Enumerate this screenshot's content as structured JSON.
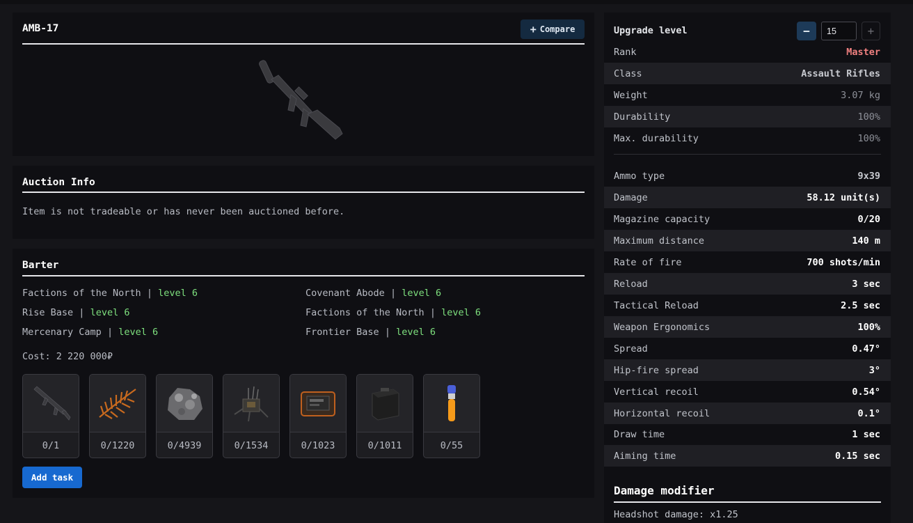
{
  "item": {
    "title": "AMB-17",
    "compare_label": "Compare",
    "compare_icon": "plus-icon"
  },
  "auction": {
    "title": "Auction Info",
    "text": "Item is not tradeable or has never been auctioned before."
  },
  "barter": {
    "title": "Barter",
    "separator": "|",
    "locations": [
      {
        "name": "Factions of the North",
        "level": "level 6"
      },
      {
        "name": "Covenant Abode",
        "level": "level 6"
      },
      {
        "name": "Rise Base",
        "level": "level 6"
      },
      {
        "name": "Factions of the North",
        "level": "level 6"
      },
      {
        "name": "Mercenary Camp",
        "level": "level 6"
      },
      {
        "name": "Frontier Base",
        "level": "level 6"
      }
    ],
    "cost": "Cost: 2 220 000₽",
    "materials": [
      {
        "icon": "rifle-icon",
        "count": "0/1"
      },
      {
        "icon": "orange-fern-icon",
        "count": "0/1220"
      },
      {
        "icon": "ore-rock-icon",
        "count": "0/4939"
      },
      {
        "icon": "device-parts-icon",
        "count": "0/1534"
      },
      {
        "icon": "tablet-device-icon",
        "count": "0/1023"
      },
      {
        "icon": "ammo-box-icon",
        "count": "0/1011"
      },
      {
        "icon": "vial-icon",
        "count": "0/55"
      }
    ],
    "add_task_label": "Add task"
  },
  "stats": {
    "upgrade_label": "Upgrade level",
    "upgrade_value": "15",
    "minus_symbol": "−",
    "plus_symbol": "+",
    "general": [
      {
        "key": "Rank",
        "value": "Master"
      },
      {
        "key": "Class",
        "value": "Assault Rifles"
      },
      {
        "key": "Weight",
        "value": "3.07 kg"
      },
      {
        "key": "Durability",
        "value": "100%"
      },
      {
        "key": "Max. durability",
        "value": "100%"
      }
    ],
    "weapon": [
      {
        "key": "Ammo type",
        "value": "9x39"
      },
      {
        "key": "Damage",
        "value": "58.12 unit(s)"
      },
      {
        "key": "Magazine capacity",
        "value": "0/20"
      },
      {
        "key": "Maximum distance",
        "value": "140 m"
      },
      {
        "key": "Rate of fire",
        "value": "700 shots/min"
      },
      {
        "key": "Reload",
        "value": "3 sec"
      },
      {
        "key": "Tactical Reload",
        "value": "2.5 sec"
      },
      {
        "key": "Weapon Ergonomics",
        "value": "100%"
      },
      {
        "key": "Spread",
        "value": "0.47°"
      },
      {
        "key": "Hip-fire spread",
        "value": "3°"
      },
      {
        "key": "Vertical recoil",
        "value": "0.54°"
      },
      {
        "key": "Horizontal recoil",
        "value": "0.1°"
      },
      {
        "key": "Draw time",
        "value": "1 sec"
      },
      {
        "key": "Aiming time",
        "value": "0.15 sec"
      }
    ],
    "damage_modifier_title": "Damage modifier",
    "headshot": "Headshot damage: x1.25"
  },
  "colors": {
    "level_green": "#7ee07e",
    "rank_red": "#f08080",
    "accent_blue": "#1769d0"
  }
}
